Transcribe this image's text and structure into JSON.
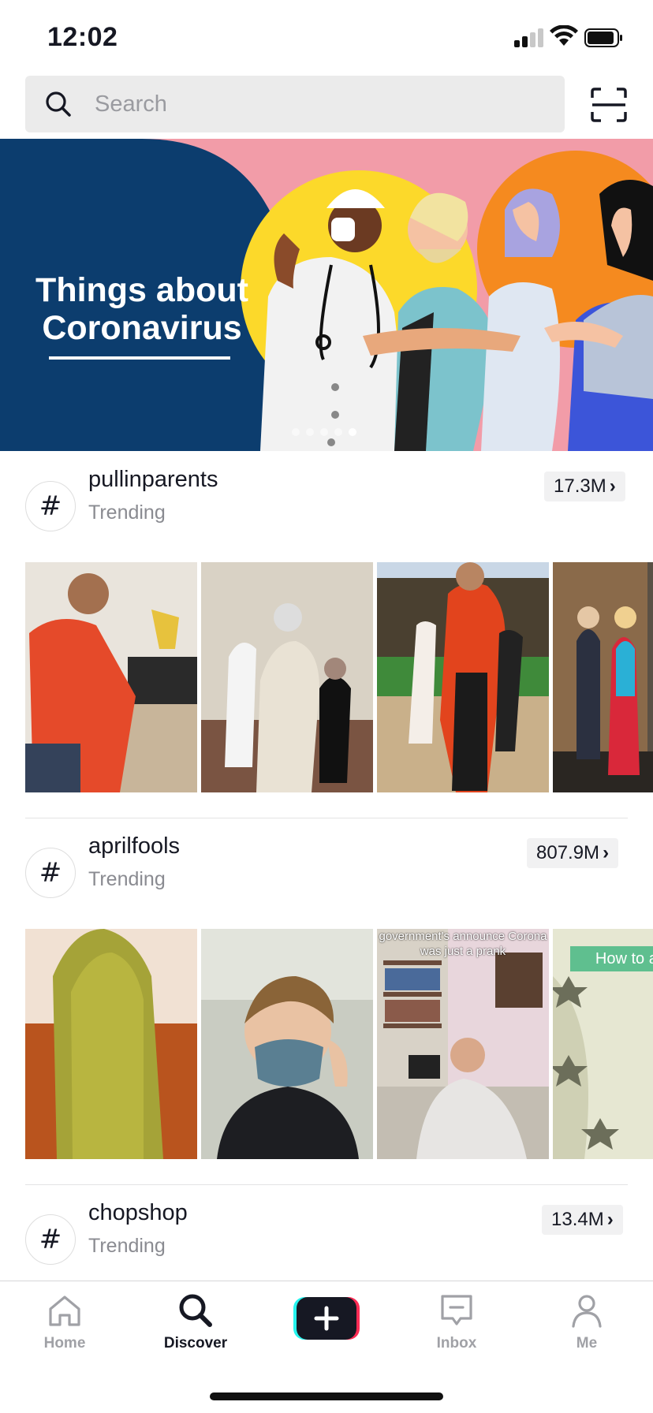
{
  "status_bar": {
    "time": "12:02"
  },
  "search": {
    "placeholder": "Search",
    "value": ""
  },
  "banner": {
    "title_line1": "Things about",
    "title_line2": "Coronavirus",
    "slide_count": 5,
    "active_slide": 4
  },
  "hashtags": [
    {
      "name": "pullinparents",
      "subtitle": "Trending",
      "count": "17.3M",
      "thumb_texts": [
        "",
        "",
        "",
        ""
      ]
    },
    {
      "name": "aprilfools",
      "subtitle": "Trending",
      "count": "807.9M",
      "thumb_texts": [
        "",
        "",
        "government's announce Corona was just a prank",
        "How to as crush o"
      ]
    },
    {
      "name": "chopshop",
      "subtitle": "Trending",
      "count": "13.4M"
    }
  ],
  "tab_bar": {
    "home": "Home",
    "discover": "Discover",
    "inbox": "Inbox",
    "me": "Me",
    "active": "discover"
  },
  "colors": {
    "banner_navy": "#0c3d6e",
    "banner_pink": "#f29ca8",
    "banner_yellow": "#fcd92a",
    "banner_orange": "#f58a1f",
    "create_cyan": "#25f4ee",
    "create_red": "#fe2c55"
  }
}
